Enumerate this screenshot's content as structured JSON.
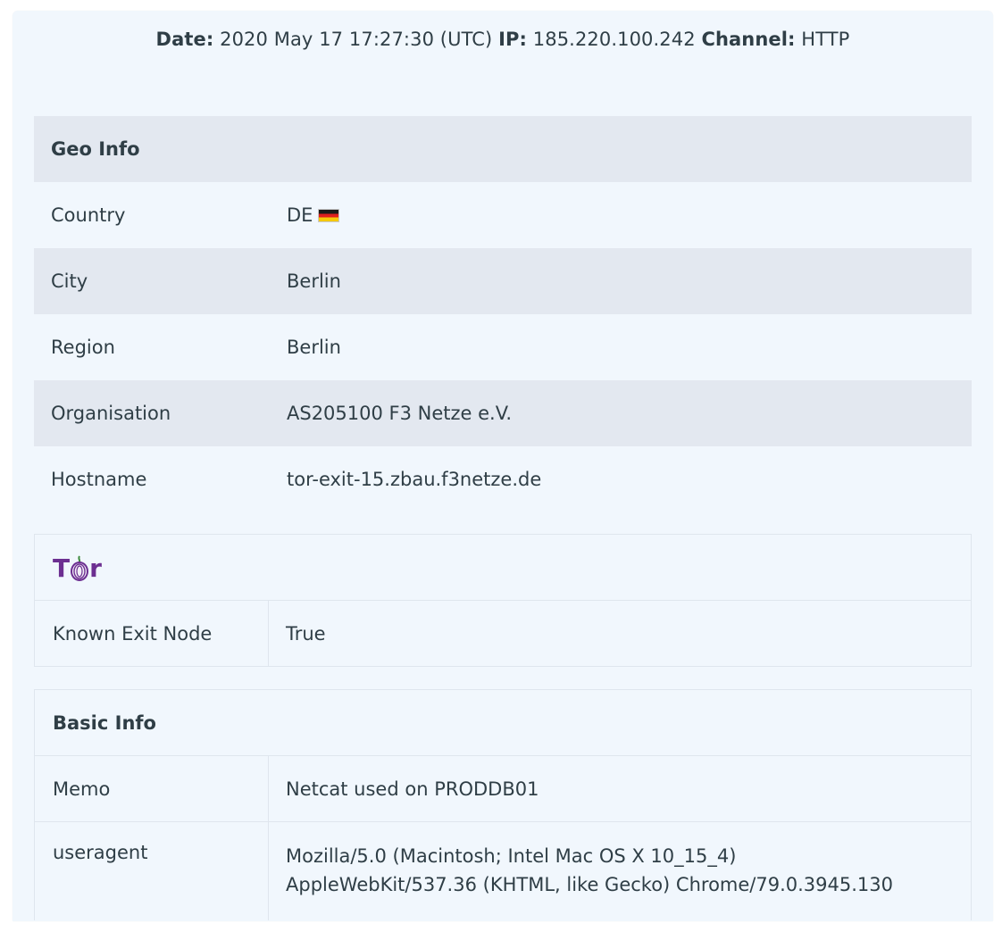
{
  "header": {
    "date_label": "Date:",
    "date_value": "2020 May 17 17:27:30 (UTC)",
    "ip_label": "IP:",
    "ip_value": "185.220.100.242",
    "channel_label": "Channel:",
    "channel_value": "HTTP"
  },
  "geo": {
    "title": "Geo Info",
    "rows": [
      {
        "key": "Country",
        "value": "DE"
      },
      {
        "key": "City",
        "value": "Berlin"
      },
      {
        "key": "Region",
        "value": "Berlin"
      },
      {
        "key": "Organisation",
        "value": "AS205100 F3 Netze e.V."
      },
      {
        "key": "Hostname",
        "value": "tor-exit-15.zbau.f3netze.de"
      }
    ]
  },
  "tor": {
    "logo_t": "T",
    "logo_r": "r",
    "rows": [
      {
        "key": "Known Exit Node",
        "value": "True"
      }
    ]
  },
  "basic": {
    "title": "Basic Info",
    "rows": [
      {
        "key": "Memo",
        "value": "Netcat used on PRODDB01"
      },
      {
        "key": "useragent",
        "value_line1": "Mozilla/5.0 (Macintosh; Intel Mac OS X 10_15_4)",
        "value_line2": "AppleWebKit/537.36 (KHTML, like Gecko) Chrome/79.0.3945.130"
      }
    ]
  },
  "colors": {
    "panel_bg": "#f1f7fd",
    "shade_row": "#e3e8f0",
    "text": "#2f3e46",
    "tor_purple": "#6c2f91"
  },
  "icons": {
    "flag": "germany-flag-icon",
    "tor": "tor-onion-icon"
  }
}
